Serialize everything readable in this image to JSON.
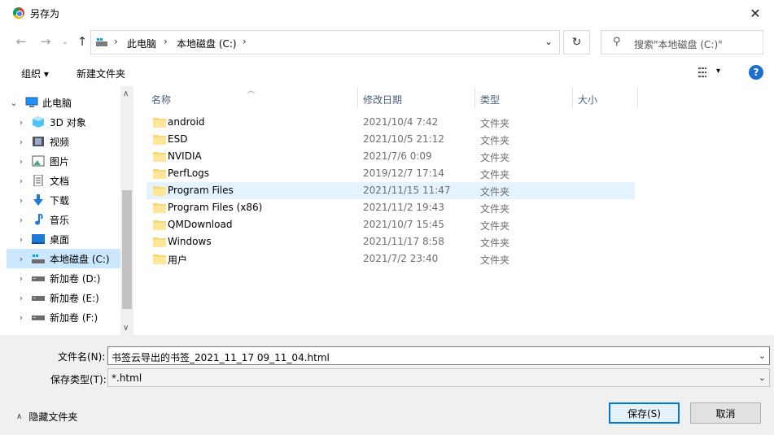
{
  "window": {
    "title": "另存为",
    "close_glyph": "✕"
  },
  "address_bar": {
    "crumbs": [
      "此电脑",
      "本地磁盘 (C:)"
    ],
    "separator": "›",
    "search_placeholder": "搜索\"本地磁盘 (C:)\""
  },
  "toolbar": {
    "organize_label": "组织 ▾",
    "new_folder_label": "新建文件夹",
    "view_dropdown_glyph": "▾",
    "help_glyph": "?"
  },
  "nav_tree": {
    "items": [
      {
        "label": "此电脑",
        "icon": "pc-icon",
        "chevron": "⌄",
        "selected": false
      },
      {
        "label": "3D 对象",
        "icon": "cube-3d-icon",
        "chevron": "›",
        "selected": false
      },
      {
        "label": "视频",
        "icon": "video-icon",
        "chevron": "›",
        "selected": false
      },
      {
        "label": "图片",
        "icon": "pictures-icon",
        "chevron": "›",
        "selected": false
      },
      {
        "label": "文档",
        "icon": "documents-icon",
        "chevron": "›",
        "selected": false
      },
      {
        "label": "下载",
        "icon": "download-icon",
        "chevron": "›",
        "selected": false
      },
      {
        "label": "音乐",
        "icon": "music-icon",
        "chevron": "›",
        "selected": false
      },
      {
        "label": "桌面",
        "icon": "desktop-icon",
        "chevron": "›",
        "selected": false
      },
      {
        "label": "本地磁盘 (C:)",
        "icon": "system-drive-icon",
        "chevron": "›",
        "selected": true
      },
      {
        "label": "新加卷 (D:)",
        "icon": "drive-icon",
        "chevron": "›",
        "selected": false
      },
      {
        "label": "新加卷 (E:)",
        "icon": "drive-icon",
        "chevron": "›",
        "selected": false
      },
      {
        "label": "新加卷 (F:)",
        "icon": "drive-icon",
        "chevron": "›",
        "selected": false
      }
    ]
  },
  "file_list": {
    "columns": [
      "名称",
      "修改日期",
      "类型",
      "大小"
    ],
    "rows": [
      {
        "name": "android",
        "date": "2021/10/4 7:42",
        "type": "文件夹"
      },
      {
        "name": "ESD",
        "date": "2021/10/5 21:12",
        "type": "文件夹"
      },
      {
        "name": "NVIDIA",
        "date": "2021/7/6 0:09",
        "type": "文件夹"
      },
      {
        "name": "PerfLogs",
        "date": "2019/12/7 17:14",
        "type": "文件夹"
      },
      {
        "name": "Program Files",
        "date": "2021/11/15 11:47",
        "type": "文件夹"
      },
      {
        "name": "Program Files (x86)",
        "date": "2021/11/2 19:43",
        "type": "文件夹"
      },
      {
        "name": "QMDownload",
        "date": "2021/10/7 15:45",
        "type": "文件夹"
      },
      {
        "name": "Windows",
        "date": "2021/11/17 8:58",
        "type": "文件夹"
      },
      {
        "name": "用户",
        "date": "2021/7/2 23:40",
        "type": "文件夹"
      }
    ],
    "hovered_row": "Program Files"
  },
  "save_form": {
    "filename_label": "文件名(N):",
    "filename_value": "书签云导出的书签_2021_11_17 09_11_04.html",
    "filetype_label": "保存类型(T):",
    "filetype_value": "*.html",
    "hide_folders_label": "隐藏文件夹",
    "save_label": "保存(S)",
    "cancel_label": "取消"
  },
  "colors": {
    "accent": "#0078d7",
    "selection": "#cce8ff",
    "hover": "#e5f3ff",
    "folder": "#f8d775"
  }
}
